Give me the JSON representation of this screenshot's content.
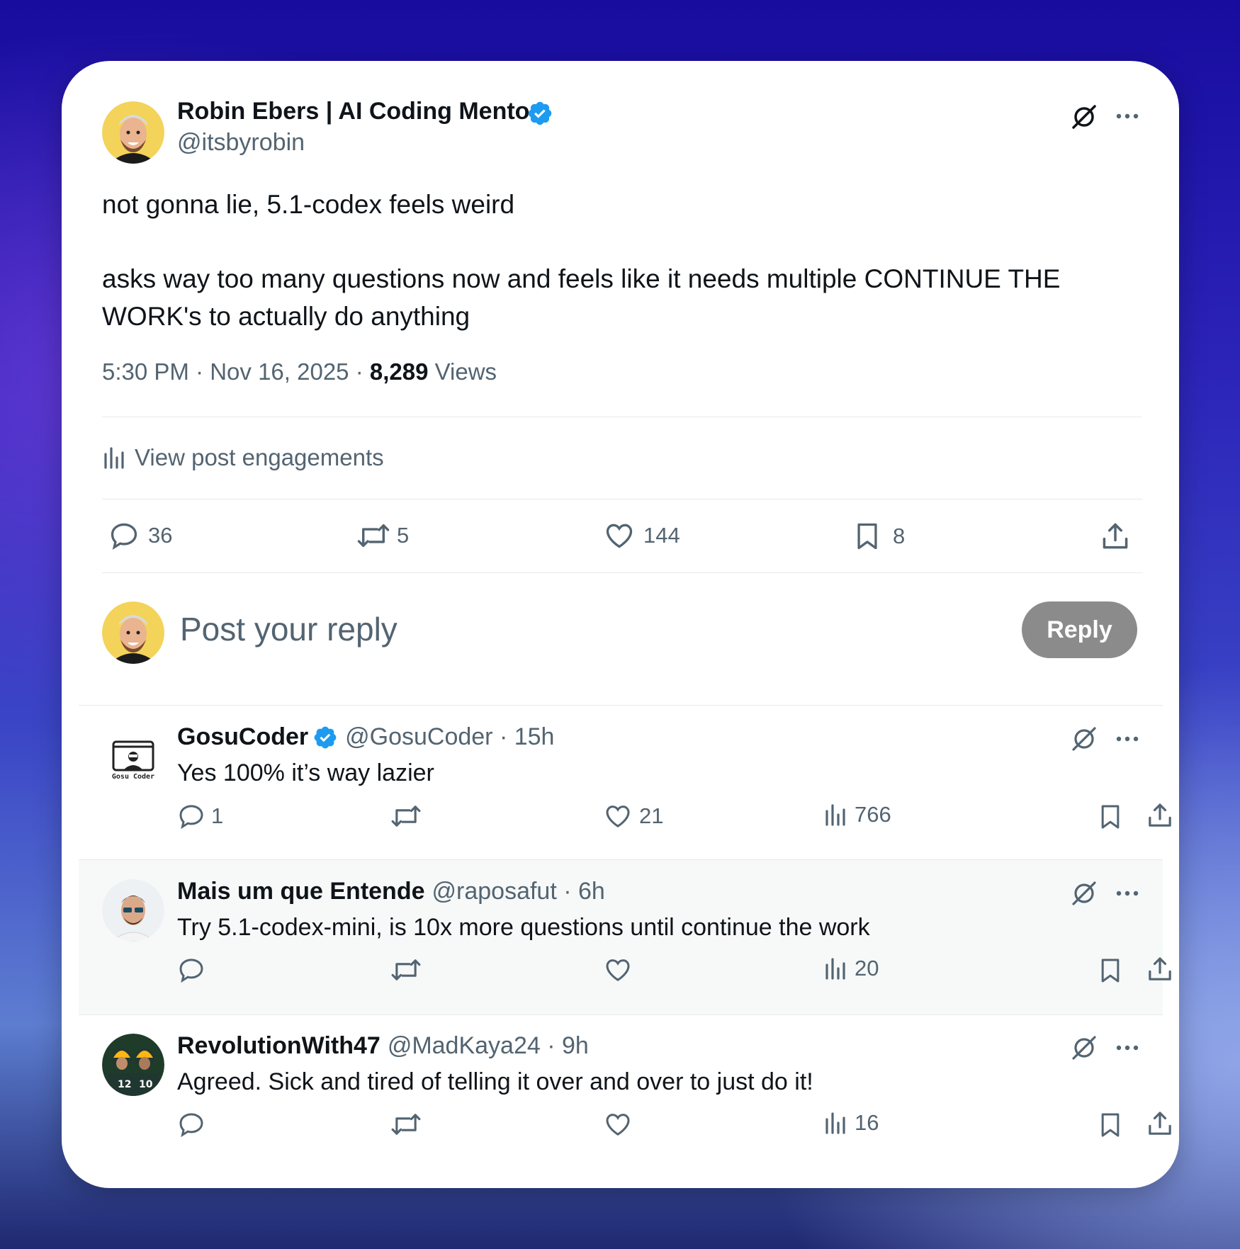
{
  "post": {
    "author_name": "Robin Ebers | AI Coding Mentor",
    "handle": "@itsbyrobin",
    "line1": "not gonna lie, 5.1-codex feels weird",
    "line2": "asks way too many questions now and feels like it needs multiple CONTINUE THE",
    "line3": "WORK's to actually do anything",
    "time": "5:30 PM · Nov 16, 2025 · ",
    "views_count": "8,289",
    "views_label": " Views",
    "engagements_label": "View post engagements",
    "stats": {
      "replies": "36",
      "reposts": "5",
      "likes": "144",
      "bookmarks": "8"
    }
  },
  "composer": {
    "placeholder": "Post your reply",
    "button_label": "Reply"
  },
  "replies": [
    {
      "name": "GosuCoder",
      "handle": "@GosuCoder · 15h",
      "text": "Yes 100% it’s way lazier",
      "avatar_text": "Gosu Coder",
      "replies": "1",
      "likes": "21",
      "views": "766"
    },
    {
      "name": "Mais um que Entende",
      "handle": "@raposafut · 6h",
      "text": "Try 5.1-codex-mini, is 10x more questions until continue the work",
      "views": "20"
    },
    {
      "name": "RevolutionWith47",
      "handle": "@MadKaya24 · 9h",
      "text": "Agreed. Sick and tired of telling it over and over to just do it!",
      "views": "16"
    }
  ],
  "colors": {
    "verified": "#1d9bf0",
    "text": "#0f1419",
    "muted": "#536471",
    "reply_button": "#8b8b8b"
  }
}
